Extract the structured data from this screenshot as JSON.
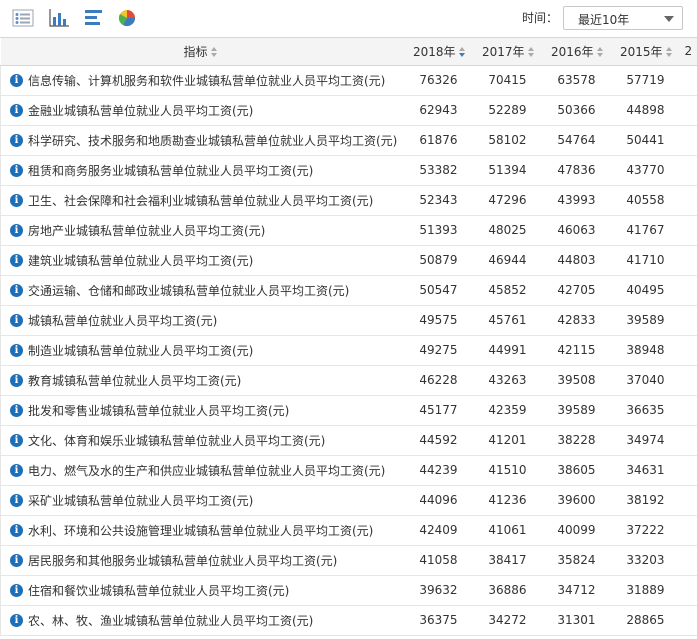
{
  "toolbar": {
    "icons": [
      "list-view-icon",
      "bar-chart-icon",
      "horizontal-bar-icon",
      "pie-chart-icon"
    ],
    "time_label": "时间：",
    "time_select": "最近10年"
  },
  "table": {
    "headers": {
      "indicator": "指标",
      "years": [
        "2018年",
        "2017年",
        "2016年",
        "2015年",
        "2"
      ]
    },
    "rows": [
      {
        "name": "信息传输、计算机服务和软件业城镇私营单位就业人员平均工资(元)",
        "values": [
          "76326",
          "70415",
          "63578",
          "57719"
        ]
      },
      {
        "name": "金融业城镇私营单位就业人员平均工资(元)",
        "values": [
          "62943",
          "52289",
          "50366",
          "44898"
        ]
      },
      {
        "name": "科学研究、技术服务和地质勘查业城镇私营单位就业人员平均工资(元)",
        "values": [
          "61876",
          "58102",
          "54764",
          "50441"
        ]
      },
      {
        "name": "租赁和商务服务业城镇私营单位就业人员平均工资(元)",
        "values": [
          "53382",
          "51394",
          "47836",
          "43770"
        ]
      },
      {
        "name": "卫生、社会保障和社会福利业城镇私营单位就业人员平均工资(元)",
        "values": [
          "52343",
          "47296",
          "43993",
          "40558"
        ]
      },
      {
        "name": "房地产业城镇私营单位就业人员平均工资(元)",
        "values": [
          "51393",
          "48025",
          "46063",
          "41767"
        ]
      },
      {
        "name": "建筑业城镇私营单位就业人员平均工资(元)",
        "values": [
          "50879",
          "46944",
          "44803",
          "41710"
        ]
      },
      {
        "name": "交通运输、仓储和邮政业城镇私营单位就业人员平均工资(元)",
        "values": [
          "50547",
          "45852",
          "42705",
          "40495"
        ]
      },
      {
        "name": "城镇私营单位就业人员平均工资(元)",
        "values": [
          "49575",
          "45761",
          "42833",
          "39589"
        ]
      },
      {
        "name": "制造业城镇私营单位就业人员平均工资(元)",
        "values": [
          "49275",
          "44991",
          "42115",
          "38948"
        ]
      },
      {
        "name": "教育城镇私营单位就业人员平均工资(元)",
        "values": [
          "46228",
          "43263",
          "39508",
          "37040"
        ]
      },
      {
        "name": "批发和零售业城镇私营单位就业人员平均工资(元)",
        "values": [
          "45177",
          "42359",
          "39589",
          "36635"
        ]
      },
      {
        "name": "文化、体育和娱乐业城镇私营单位就业人员平均工资(元)",
        "values": [
          "44592",
          "41201",
          "38228",
          "34974"
        ]
      },
      {
        "name": "电力、燃气及水的生产和供应业城镇私营单位就业人员平均工资(元)",
        "values": [
          "44239",
          "41510",
          "38605",
          "34631"
        ]
      },
      {
        "name": "采矿业城镇私营单位就业人员平均工资(元)",
        "values": [
          "44096",
          "41236",
          "39600",
          "38192"
        ]
      },
      {
        "name": "水利、环境和公共设施管理业城镇私营单位就业人员平均工资(元)",
        "values": [
          "42409",
          "41061",
          "40099",
          "37222"
        ]
      },
      {
        "name": "居民服务和其他服务业城镇私营单位就业人员平均工资(元)",
        "values": [
          "41058",
          "38417",
          "35824",
          "33203"
        ]
      },
      {
        "name": "住宿和餐饮业城镇私营单位就业人员平均工资(元)",
        "values": [
          "39632",
          "36886",
          "34712",
          "31889"
        ]
      },
      {
        "name": "农、林、牧、渔业城镇私营单位就业人员平均工资(元)",
        "values": [
          "36375",
          "34272",
          "31301",
          "28865"
        ]
      }
    ]
  }
}
